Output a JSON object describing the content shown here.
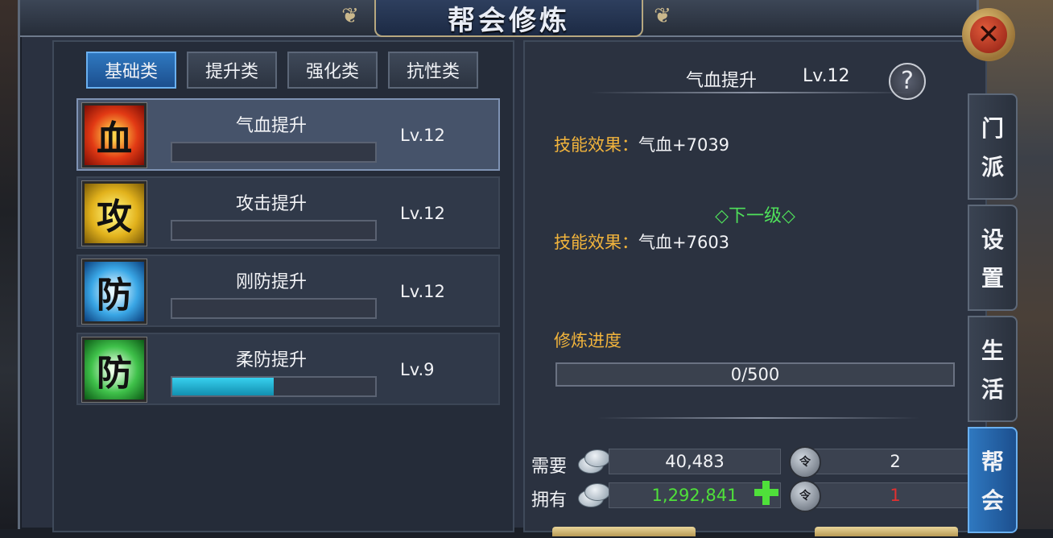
{
  "window": {
    "title": "帮会修炼"
  },
  "tabs": [
    {
      "label": "基础类",
      "active": true
    },
    {
      "label": "提升类",
      "active": false
    },
    {
      "label": "强化类",
      "active": false
    },
    {
      "label": "抗性类",
      "active": false
    }
  ],
  "skills": [
    {
      "icon_char": "血",
      "icon_color": "red",
      "name": "气血提升",
      "level": "Lv.12",
      "progress": 0.0,
      "selected": true
    },
    {
      "icon_char": "攻",
      "icon_color": "yellow",
      "name": "攻击提升",
      "level": "Lv.12",
      "progress": 0.0,
      "selected": false
    },
    {
      "icon_char": "防",
      "icon_color": "blue",
      "name": "刚防提升",
      "level": "Lv.12",
      "progress": 0.0,
      "selected": false
    },
    {
      "icon_char": "防",
      "icon_color": "green",
      "name": "柔防提升",
      "level": "Lv.9",
      "progress": 0.5,
      "selected": false
    }
  ],
  "detail": {
    "name": "气血提升",
    "level": "Lv.12",
    "help_symbol": "?",
    "current_effect_label": "技能效果：",
    "current_effect_value": "气血+7039",
    "next_level_label": "◇下一级◇",
    "next_effect_label": "技能效果：",
    "next_effect_value": "气血+7603",
    "progress_title": "修炼进度",
    "progress_text": "0/500"
  },
  "costs": {
    "need_label": "需要",
    "need_silver": "40,483",
    "need_tokens": "2",
    "have_label": "拥有",
    "have_silver": "1,292,841",
    "have_tokens": "1",
    "have_silver_color": "#4fe03a",
    "have_tokens_color": "#e03030"
  },
  "side_tabs": [
    {
      "chars": [
        "门",
        "派"
      ],
      "active": false
    },
    {
      "chars": [
        "设",
        "置"
      ],
      "active": false
    },
    {
      "chars": [
        "生",
        "活"
      ],
      "active": false
    },
    {
      "chars": [
        "帮",
        "会"
      ],
      "active": true
    }
  ],
  "icons": {
    "close": "close-icon",
    "silver": "silver-coin-icon",
    "token": "guild-token-icon",
    "add": "plus-icon",
    "help": "question-icon"
  }
}
